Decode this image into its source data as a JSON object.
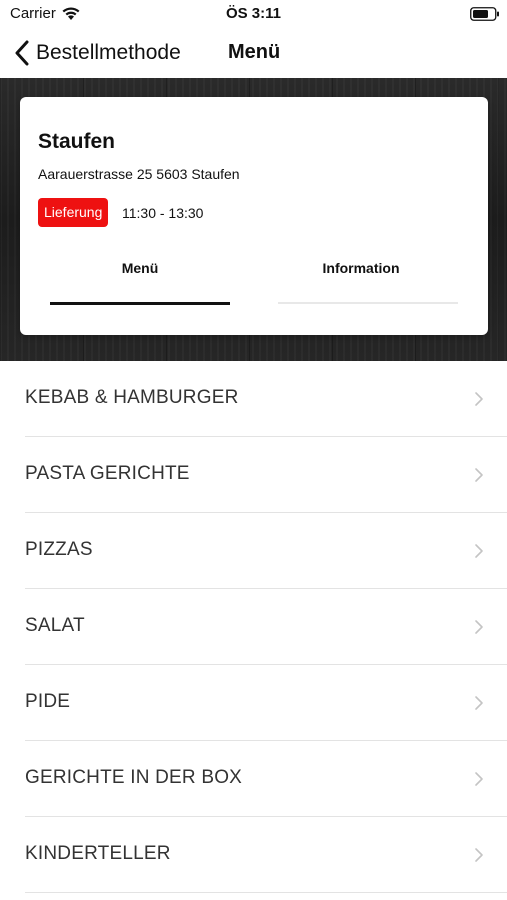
{
  "status_bar": {
    "carrier": "Carrier",
    "time": "ÖS 3:11",
    "wifi_icon": "wifi-icon",
    "battery_icon": "battery-icon"
  },
  "nav": {
    "back_label": "Bestellmethode",
    "title": "Menü"
  },
  "store": {
    "name": "Staufen",
    "address": "Aarauerstrasse 25 5603 Staufen",
    "badge": "Lieferung",
    "badge_color": "#ee1111",
    "hours": "11:30 - 13:30"
  },
  "tabs": [
    {
      "label": "Menü",
      "active": true
    },
    {
      "label": "Information",
      "active": false
    }
  ],
  "categories": [
    {
      "label": "KEBAB & HAMBURGER"
    },
    {
      "label": "PASTA GERICHTE"
    },
    {
      "label": "PIZZAS"
    },
    {
      "label": "SALAT"
    },
    {
      "label": "PIDE"
    },
    {
      "label": "GERICHTE IN DER BOX"
    },
    {
      "label": "KINDERTELLER"
    }
  ]
}
